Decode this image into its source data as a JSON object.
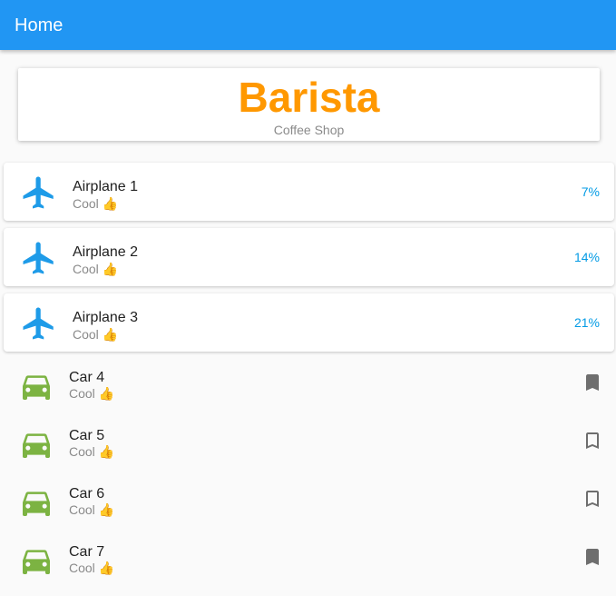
{
  "appbar": {
    "title": "Home",
    "color": "#2196f3"
  },
  "header_card": {
    "title": "Barista",
    "subtitle": "Coffee Shop",
    "title_color": "#ff9800"
  },
  "airplanes": [
    {
      "title": "Airplane 1",
      "subtitle": "Cool 👍",
      "percent": "7%",
      "icon": "airplane-icon"
    },
    {
      "title": "Airplane 2",
      "subtitle": "Cool 👍",
      "percent": "14%",
      "icon": "airplane-icon"
    },
    {
      "title": "Airplane 3",
      "subtitle": "Cool 👍",
      "percent": "21%",
      "icon": "airplane-icon"
    }
  ],
  "cars": [
    {
      "title": "Car 4",
      "subtitle": "Cool 👍",
      "icon": "car-icon",
      "bookmarked": true
    },
    {
      "title": "Car 5",
      "subtitle": "Cool 👍",
      "icon": "car-icon",
      "bookmarked": false
    },
    {
      "title": "Car 6",
      "subtitle": "Cool 👍",
      "icon": "car-icon",
      "bookmarked": false
    },
    {
      "title": "Car 7",
      "subtitle": "Cool 👍",
      "icon": "car-icon",
      "bookmarked": true
    }
  ],
  "colors": {
    "airplane": "#1e9be8",
    "car": "#7cb342",
    "percent": "#039be5",
    "bookmark": "#6e6e6e"
  }
}
